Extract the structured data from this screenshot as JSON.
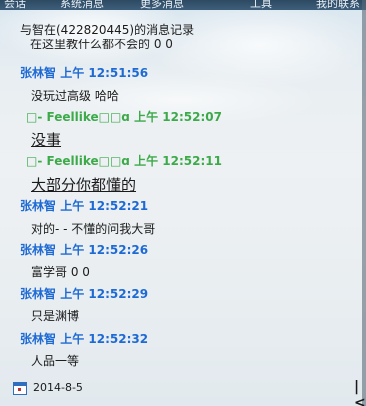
{
  "menu": [
    "会话",
    "系统消息",
    "更多消息",
    "工具",
    "我的联系"
  ],
  "header": "与智在(422820445)的消息记录",
  "cut_text": "在这里教什么都不会的 0 0",
  "entries": [
    {
      "sender": "张林智",
      "time": "上午 12:51:56",
      "color": "blue",
      "text": "没玩过高级 哈哈",
      "big": false
    },
    {
      "sender": "□-  Feellike□□ɑ",
      "time": "上午 12:52:07",
      "color": "green",
      "text": "没事",
      "big": true
    },
    {
      "sender": "□-  Feellike□□ɑ",
      "time": "上午 12:52:11",
      "color": "green",
      "text": "大部分你都懂的",
      "big": true
    },
    {
      "sender": "张林智",
      "time": "上午 12:52:21",
      "color": "blue",
      "text": "对的- - 不懂的问我大哥",
      "big": false
    },
    {
      "sender": "张林智",
      "time": "上午 12:52:26",
      "color": "blue",
      "text": "富学哥 0 0",
      "big": false
    },
    {
      "sender": "张林智",
      "time": "上午 12:52:29",
      "color": "blue",
      "text": "只是渊博",
      "big": false
    },
    {
      "sender": "张林智",
      "time": "上午 12:52:32",
      "color": "blue",
      "text": "人品一等",
      "big": false
    }
  ],
  "footer": {
    "date": "2014-8-5",
    "first_page_label": "|<"
  },
  "colors": {
    "sender_blue": "#1e6ad4",
    "sender_green": "#3daa4a"
  }
}
